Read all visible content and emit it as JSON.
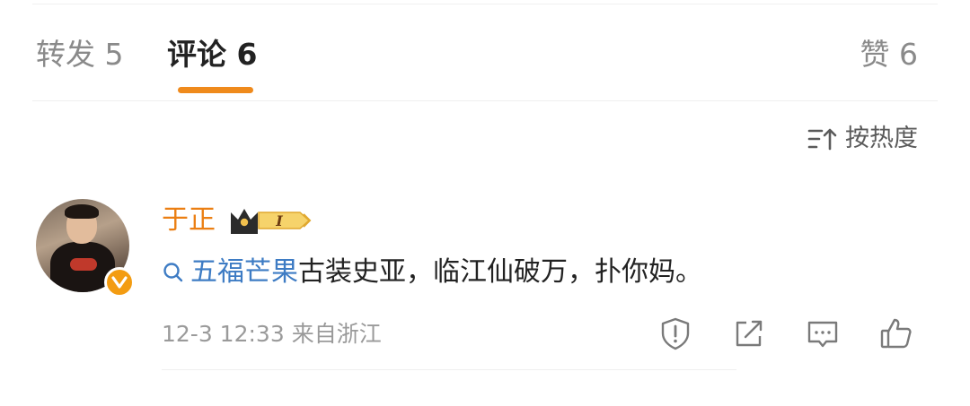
{
  "tabs": {
    "repost": "转发 5",
    "comments": "评论 6",
    "likes": "赞 6"
  },
  "sort": {
    "label": "按热度",
    "icon": "sort-icon"
  },
  "comment": {
    "username": "于正",
    "vip_level": "I",
    "topic": "五福芒果",
    "text": "古装史亚，临江仙破万，扑你妈。",
    "timestamp": "12-3 12:33",
    "location": "来自浙江"
  },
  "colors": {
    "accent": "#ef8a1c",
    "username": "#eb7f13",
    "link": "#3e7cc4",
    "muted": "#9a9a9a"
  },
  "icons": [
    "search-icon",
    "report-icon",
    "share-icon",
    "comment-icon",
    "like-icon",
    "verified-icon",
    "crown-icon"
  ]
}
